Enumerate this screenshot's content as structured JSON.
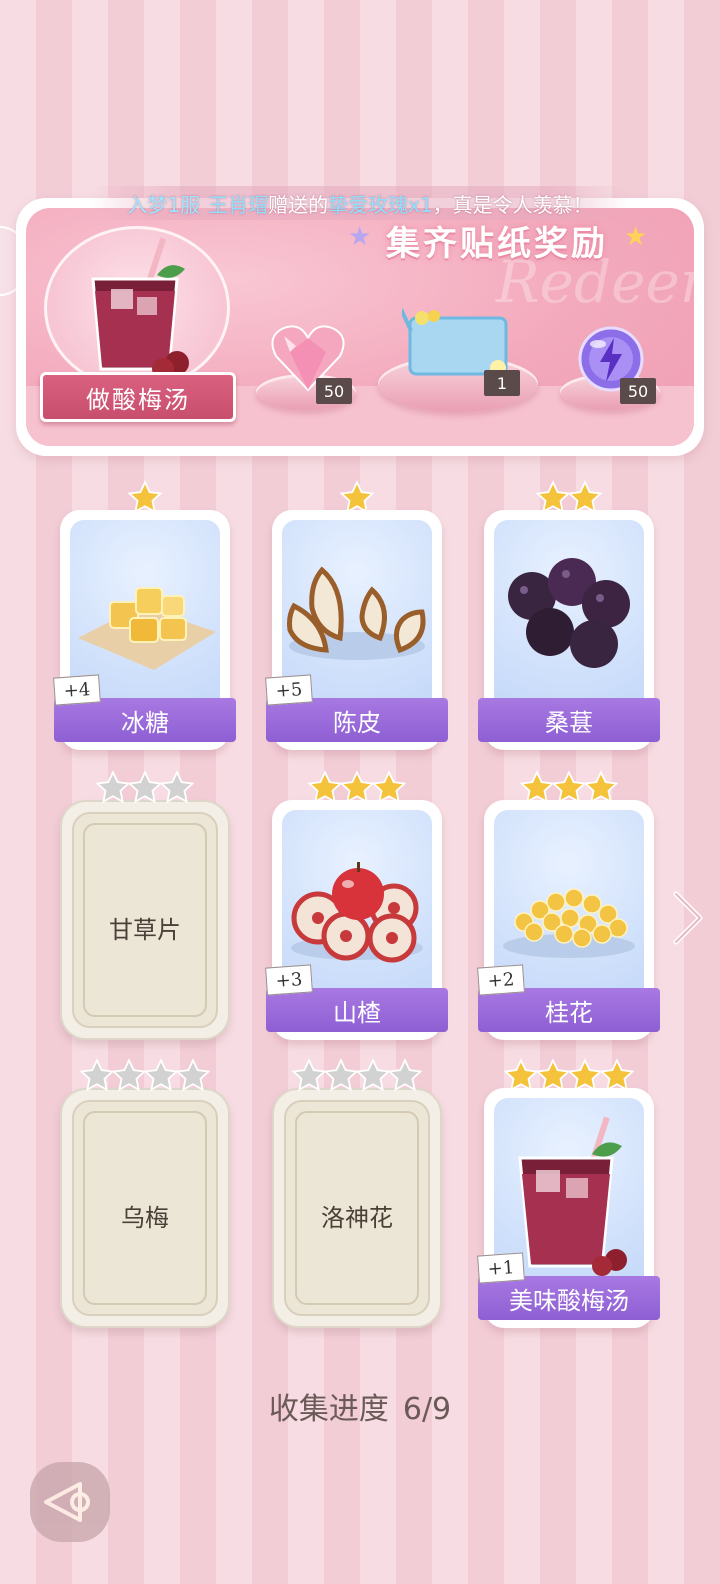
{
  "marquee": {
    "server": "入梦1服",
    "player": "王肖瑁",
    "text1": "赠送的",
    "gift": "挚爱玫瑰x1",
    "text2": "，真是令人羡慕！"
  },
  "banner": {
    "title": "集齐贴纸奖励",
    "watermark": "Redeem",
    "task_label": "做酸梅汤",
    "rewards": [
      {
        "icon": "pink-heart-gem-icon",
        "count": "50"
      },
      {
        "icon": "blue-ticket-drink-icon",
        "count": "1"
      },
      {
        "icon": "purple-energy-orb-icon",
        "count": "50"
      }
    ]
  },
  "cards": [
    {
      "name": "冰糖",
      "stars": 1,
      "unlocked": true,
      "bonus": "+4",
      "icon": "rock-sugar-icon"
    },
    {
      "name": "陈皮",
      "stars": 1,
      "unlocked": true,
      "bonus": "+5",
      "icon": "orange-peel-icon"
    },
    {
      "name": "桑葚",
      "stars": 2,
      "unlocked": true,
      "bonus": "",
      "icon": "mulberry-icon"
    },
    {
      "name": "甘草片",
      "stars": 3,
      "unlocked": false,
      "bonus": ""
    },
    {
      "name": "山楂",
      "stars": 3,
      "unlocked": true,
      "bonus": "+3",
      "icon": "hawthorn-icon"
    },
    {
      "name": "桂花",
      "stars": 3,
      "unlocked": true,
      "bonus": "+2",
      "icon": "osmanthus-icon"
    },
    {
      "name": "乌梅",
      "stars": 4,
      "unlocked": false,
      "bonus": ""
    },
    {
      "name": "洛神花",
      "stars": 4,
      "unlocked": false,
      "bonus": ""
    },
    {
      "name": "美味酸梅汤",
      "stars": 4,
      "unlocked": true,
      "bonus": "+1",
      "icon": "plum-drink-icon"
    }
  ],
  "progress": {
    "label": "收集进度",
    "value": "6/9"
  },
  "colors": {
    "accent_purple": "#9a6ad9",
    "banner_pink": "#f3a9bc",
    "star_gold": "#f5c33b",
    "star_gray": "#c9c9c9"
  }
}
